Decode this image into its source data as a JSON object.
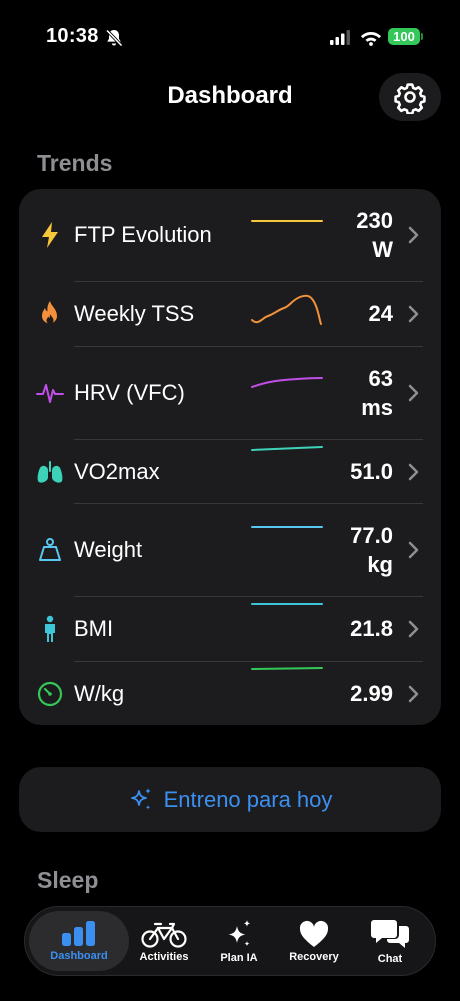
{
  "status_bar": {
    "time": "10:38",
    "battery": "100",
    "icons": [
      "bell-slash-icon",
      "signal-icon",
      "wifi-icon",
      "battery-icon"
    ]
  },
  "header": {
    "title": "Dashboard",
    "settings_icon": "gear-icon"
  },
  "trends": {
    "title": "Trends",
    "items": [
      {
        "label": "FTP Evolution",
        "value_line1": "230",
        "value_line2": "W",
        "icon": "bolt-icon",
        "color": "#f7c73b"
      },
      {
        "label": "Weekly TSS",
        "value_line1": "24",
        "value_line2": "",
        "icon": "flame-icon",
        "color": "#f2913a"
      },
      {
        "label": "HRV (VFC)",
        "value_line1": "63",
        "value_line2": "ms",
        "icon": "waveform-icon",
        "color": "#c04ee8"
      },
      {
        "label": "VO2max",
        "value_line1": "51.0",
        "value_line2": "",
        "icon": "lungs-icon",
        "color": "#3dd3b8"
      },
      {
        "label": "Weight",
        "value_line1": "77.0",
        "value_line2": "kg",
        "icon": "scale-icon",
        "color": "#59c8f0"
      },
      {
        "label": "BMI",
        "value_line1": "21.8",
        "value_line2": "",
        "icon": "person-icon",
        "color": "#3dc6d8"
      },
      {
        "label": "W/kg",
        "value_line1": "2.99",
        "value_line2": "",
        "icon": "gauge-icon",
        "color": "#34c759"
      }
    ]
  },
  "today_button": {
    "label": "Entreno para hoy",
    "icon": "sparkles-icon",
    "color": "#3b8ff0"
  },
  "sleep": {
    "title": "Sleep"
  },
  "tab_bar": {
    "tabs": [
      {
        "label": "Dashboard",
        "icon": "chart-bars-icon",
        "active": true
      },
      {
        "label": "Activities",
        "icon": "bicycle-icon",
        "active": false
      },
      {
        "label": "Plan IA",
        "icon": "sparkles-icon",
        "active": false
      },
      {
        "label": "Recovery",
        "icon": "heart-icon",
        "active": false
      },
      {
        "label": "Chat",
        "icon": "chat-bubbles-icon",
        "active": false
      }
    ]
  }
}
